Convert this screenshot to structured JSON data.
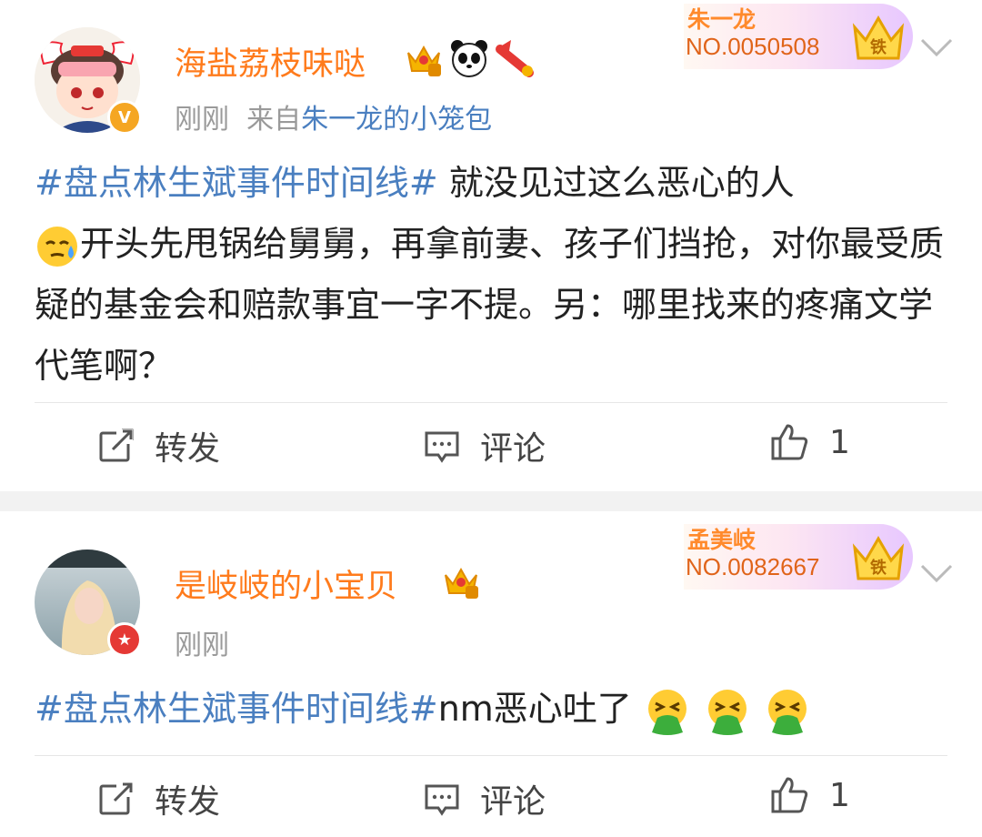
{
  "posts": [
    {
      "username": "海盐荔枝味哒",
      "time": "刚刚",
      "source_prefix": "来自",
      "source": "朱一龙的小笼包",
      "fan_badge": {
        "name": "朱一龙",
        "number": "NO.0050508",
        "level": "铁"
      },
      "hashtag": "#盘点林生斌事件时间线#",
      "text_part1": " 就没见过这么恶心的人",
      "text_part2": "开头先甩锅给舅舅，再拿前妻、孩子们挡抢，对你最受质疑的基金会和赔款事宜一字不提。另：哪里找来的疼痛文学代笔啊？",
      "actions": {
        "repost": "转发",
        "comment": "评论",
        "like_count": "1"
      },
      "badge_icons": [
        "crown-badge-icon",
        "panda-icon",
        "gift-icon"
      ]
    },
    {
      "username": "是岐岐的小宝贝",
      "time": "刚刚",
      "fan_badge": {
        "name": "孟美岐",
        "number": "NO.0082667",
        "level": "铁"
      },
      "hashtag": "#盘点林生斌事件时间线#",
      "text_part1": "nm恶心吐了",
      "actions": {
        "repost": "转发",
        "comment": "评论",
        "like_count": "1"
      },
      "badge_icons": [
        "crown-badge-icon"
      ]
    }
  ],
  "colors": {
    "username": "#ff7b1c",
    "link": "#4a7fc0",
    "meta": "#9a9a9a"
  }
}
